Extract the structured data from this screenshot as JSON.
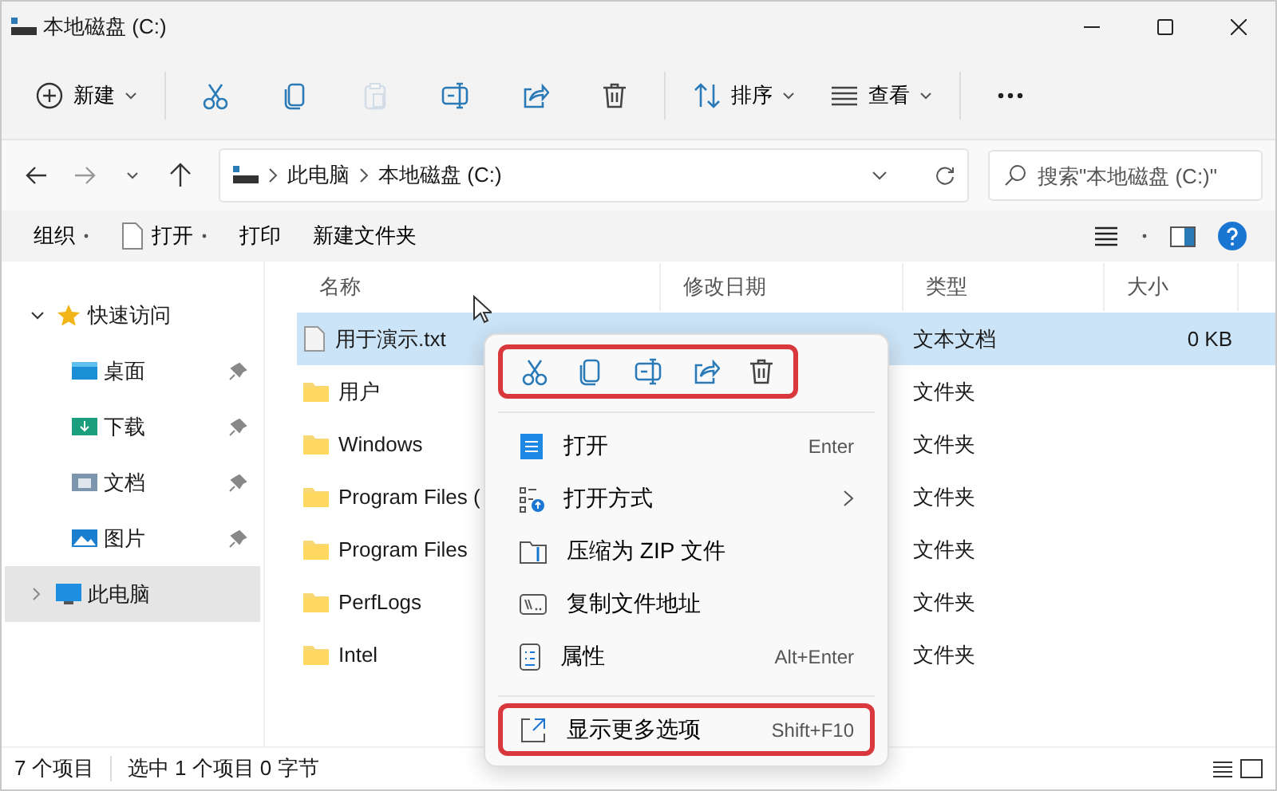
{
  "window": {
    "title": "本地磁盘 (C:)"
  },
  "toolbar": [
    {
      "kind": "new",
      "label": "新建",
      "dropdown": true,
      "disabled": false
    },
    {
      "kind": "cut",
      "disabled": false
    },
    {
      "kind": "copy",
      "disabled": false
    },
    {
      "kind": "paste",
      "disabled": true
    },
    {
      "kind": "rename",
      "disabled": false
    },
    {
      "kind": "share",
      "disabled": false
    },
    {
      "kind": "delete",
      "disabled": false
    },
    {
      "kind": "sort",
      "label": "排序",
      "dropdown": true,
      "disabled": false
    },
    {
      "kind": "view",
      "label": "查看",
      "dropdown": true,
      "disabled": false
    },
    {
      "kind": "more",
      "disabled": false
    }
  ],
  "address": {
    "path": [
      "此电脑",
      "本地磁盘 (C:)"
    ]
  },
  "search": {
    "placeholder": "搜索\"本地磁盘 (C:)\""
  },
  "commands": [
    {
      "label": "组织",
      "dropdown": true,
      "icon": false
    },
    {
      "label": "打开",
      "dropdown": true,
      "icon": true
    },
    {
      "label": "打印",
      "dropdown": false,
      "icon": false
    },
    {
      "label": "新建文件夹",
      "dropdown": false,
      "icon": false
    }
  ],
  "sidebar": {
    "items": [
      {
        "label": "快速访问",
        "kind": "star",
        "expanded": true,
        "selected": false,
        "children": [
          {
            "label": "桌面",
            "kind": "desktop",
            "pinned": true,
            "selected": false
          },
          {
            "label": "下载",
            "kind": "downloads",
            "pinned": true,
            "selected": false
          },
          {
            "label": "文档",
            "kind": "documents",
            "pinned": true,
            "selected": false
          },
          {
            "label": "图片",
            "kind": "pictures",
            "pinned": true,
            "selected": false
          }
        ]
      },
      {
        "label": "此电脑",
        "kind": "pc",
        "expanded": false,
        "selected": true
      }
    ]
  },
  "table": {
    "columns": [
      "名称",
      "修改日期",
      "类型",
      "大小"
    ],
    "rows": [
      {
        "name": "用于演示.txt",
        "kind": "file",
        "type": "文本文档",
        "size": "0 KB",
        "selected": true
      },
      {
        "name": "用户",
        "kind": "folder",
        "type": "文件夹",
        "selected": false
      },
      {
        "name": "Windows",
        "kind": "folder",
        "type": "文件夹",
        "selected": false
      },
      {
        "name": "Program Files (",
        "kind": "folder",
        "type": "文件夹",
        "selected": false
      },
      {
        "name": "Program Files",
        "kind": "folder",
        "type": "文件夹",
        "selected": false
      },
      {
        "name": "PerfLogs",
        "kind": "folder",
        "type": "文件夹",
        "selected": false
      },
      {
        "name": "Intel",
        "kind": "folder",
        "type": "文件夹",
        "selected": false
      }
    ]
  },
  "context_menu": {
    "quick_actions_highlighted": true,
    "quick_actions": [
      {
        "kind": "cut"
      },
      {
        "kind": "copy"
      },
      {
        "kind": "rename"
      },
      {
        "kind": "share"
      },
      {
        "kind": "delete"
      }
    ],
    "items": [
      {
        "kind": "open",
        "label": "打开",
        "shortcut": "Enter",
        "submenu": false,
        "highlighted": false
      },
      {
        "kind": "openwith",
        "label": "打开方式",
        "submenu": true,
        "highlighted": false
      },
      {
        "kind": "zip",
        "label": "压缩为 ZIP 文件",
        "submenu": false,
        "highlighted": false
      },
      {
        "kind": "path",
        "label": "复制文件地址",
        "submenu": false,
        "highlighted": false
      },
      {
        "kind": "properties",
        "label": "属性",
        "shortcut": "Alt+Enter",
        "submenu": false,
        "highlighted": false
      },
      {
        "kind": "more",
        "label": "显示更多选项",
        "shortcut": "Shift+F10",
        "submenu": false,
        "highlighted": true
      }
    ]
  },
  "status_bar": {
    "count": "7 个项目",
    "selection": "选中 1 个项目  0 字节"
  }
}
